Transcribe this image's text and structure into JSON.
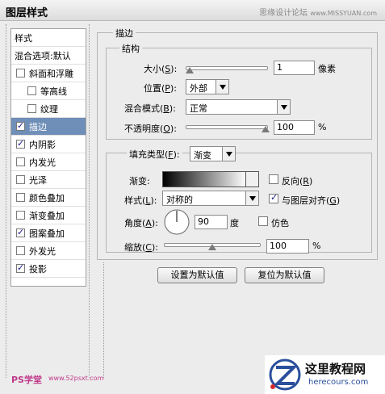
{
  "title": "图层样式",
  "watermark_top": "思缘设计论坛",
  "watermark_top_url": "www.MISSYUAN.com",
  "sidebar": {
    "header": "样式",
    "blend_default": "混合选项:默认",
    "items": [
      {
        "label": "斜面和浮雕",
        "checked": false,
        "indent": false
      },
      {
        "label": "等高线",
        "checked": false,
        "indent": true
      },
      {
        "label": "纹理",
        "checked": false,
        "indent": true
      },
      {
        "label": "描边",
        "checked": true,
        "indent": false,
        "selected": true
      },
      {
        "label": "内阴影",
        "checked": true,
        "indent": false
      },
      {
        "label": "内发光",
        "checked": false,
        "indent": false
      },
      {
        "label": "光泽",
        "checked": false,
        "indent": false
      },
      {
        "label": "颜色叠加",
        "checked": false,
        "indent": false
      },
      {
        "label": "渐变叠加",
        "checked": false,
        "indent": false
      },
      {
        "label": "图案叠加",
        "checked": true,
        "indent": false
      },
      {
        "label": "外发光",
        "checked": false,
        "indent": false
      },
      {
        "label": "投影",
        "checked": true,
        "indent": false
      }
    ]
  },
  "stroke": {
    "group_label": "描边",
    "structure_label": "结构",
    "size_label": "大小(",
    "size_key": "S",
    "size_value": "1",
    "size_unit": "像素",
    "size_level": 0.02,
    "position_label": "位置(",
    "position_key": "P",
    "position_value": "外部",
    "blend_label": "混合模式(",
    "blend_key": "B",
    "blend_value": "正常",
    "opacity_label": "不透明度(",
    "opacity_key": "O",
    "opacity_value": "100",
    "opacity_unit": "%",
    "opacity_level": 1.0,
    "fill_type_label": "填充类型(",
    "fill_type_key": "F",
    "fill_type_value": "渐变",
    "gradient_label": "渐变:",
    "reverse_label": "反向(",
    "reverse_key": "R",
    "reverse_checked": false,
    "style_label": "样式(",
    "style_key": "L",
    "style_value": "对称的",
    "align_label": "与图层对齐(",
    "align_key": "G",
    "align_checked": true,
    "angle_label": "角度(",
    "angle_key": "A",
    "angle_value": "90",
    "angle_unit": "度",
    "dither_label": "仿色",
    "dither_checked": false,
    "scale_label": "缩放(",
    "scale_key": "C",
    "scale_value": "100",
    "scale_unit": "%",
    "scale_level": 0.5
  },
  "buttons": {
    "make_default": "设置为默认值",
    "reset_default": "复位为默认值"
  },
  "watermark_bottom_left": "PS学堂",
  "watermark_bottom_left_url": "www.52psxt.com",
  "watermark_bottom_right": "这里教程网",
  "watermark_bottom_right_url": "herecours.com",
  "colors": {
    "selected_bg": "#6f8fb8",
    "logo_blue": "#2a4f9c"
  }
}
